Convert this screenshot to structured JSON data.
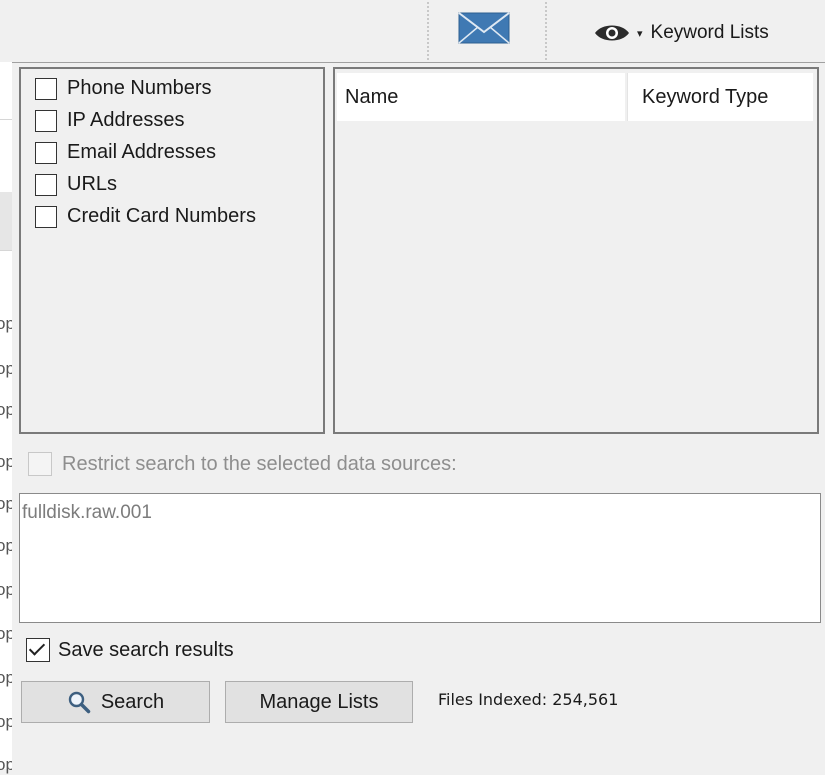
{
  "toolbar": {
    "email_icon": "envelope-icon",
    "keyword_lists": {
      "icon": "eye-icon",
      "caret": "▾",
      "label": "Keyword Lists"
    }
  },
  "background_table": {
    "fragments": [
      "op",
      "op",
      "op",
      "op",
      "op",
      "op",
      "op",
      "op",
      "op",
      "op",
      "op"
    ]
  },
  "regex_checkboxes": [
    {
      "label": "Phone Numbers",
      "checked": false
    },
    {
      "label": "IP Addresses",
      "checked": false
    },
    {
      "label": "Email Addresses",
      "checked": false
    },
    {
      "label": "URLs",
      "checked": false
    },
    {
      "label": "Credit Card Numbers",
      "checked": false
    }
  ],
  "lists_table": {
    "columns": [
      "Name",
      "Keyword Type"
    ],
    "rows": []
  },
  "restrict": {
    "label": "Restrict search to the selected data sources:",
    "checked": false,
    "enabled": false
  },
  "data_sources": [
    "fulldisk.raw.001"
  ],
  "save_results": {
    "label": "Save search results",
    "checked": true
  },
  "buttons": {
    "search_label": "Search",
    "manage_label": "Manage Lists"
  },
  "status": {
    "files_indexed": "Files Indexed: 254,561"
  },
  "colors": {
    "envelope": "#3f79b3",
    "panel_bg": "#f0f0f0",
    "button_bg": "#e1e1e1"
  }
}
